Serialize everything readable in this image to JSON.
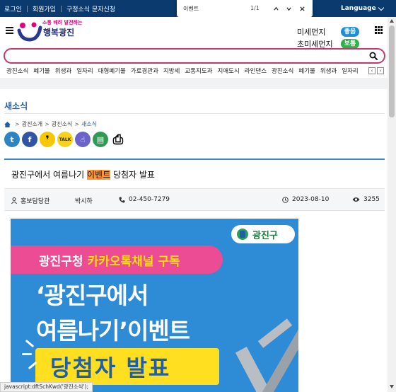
{
  "topbar": {
    "links": [
      "로그인",
      "회원가입",
      "구정소식 문자신청"
    ],
    "language": "Language"
  },
  "findbar": {
    "query": "이벤트",
    "count": "1/1"
  },
  "header": {
    "logo_tagline": "소통 배려 발전하는",
    "logo_name": "행복광진",
    "dust": [
      {
        "label": "미세먼지",
        "status": "좋음",
        "color": "#1f8ed6"
      },
      {
        "label": "초미세먼지",
        "status": "보통",
        "color": "#2eb24a"
      }
    ]
  },
  "search": {
    "value": "",
    "placeholder": ""
  },
  "nav": {
    "items": [
      "광진소식",
      "폐기물",
      "위생과",
      "일자리",
      "대형폐기물",
      "가로경관과",
      "지방세",
      "교통지도과",
      "지애도시",
      "라인댄스",
      "광진소식",
      "폐기물",
      "위생과",
      "일자리"
    ]
  },
  "section": {
    "title": "새소식",
    "breadcrumb": [
      "광진소개",
      "광진소식",
      "새소식"
    ]
  },
  "share_icons": [
    {
      "name": "twitter-icon",
      "glyph": "t",
      "color": "#2d84c5"
    },
    {
      "name": "facebook-icon",
      "glyph": "f",
      "color": "#2f55a4"
    },
    {
      "name": "quote-icon",
      "glyph": "❜",
      "color": "#111111"
    },
    {
      "name": "kakaotalk-icon",
      "glyph": "TALK",
      "color": "#f7d21a"
    },
    {
      "name": "link-icon",
      "glyph": "☝",
      "color": "#6b63c9"
    },
    {
      "name": "document-icon",
      "glyph": "▤",
      "color": "#2f9a55"
    },
    {
      "name": "print-icon",
      "glyph": "⎙",
      "color": "#111111"
    }
  ],
  "post": {
    "title_before": "광진구에서 여름나기 ",
    "title_highlight": "이벤트",
    "title_after": " 당첨자 발표",
    "department": "홍보담당관",
    "author": "박시하",
    "phone": "02-450-7279",
    "date": "2023-08-10",
    "views": "3255"
  },
  "banner": {
    "org": "광진구",
    "subtitle_prefix": "광진구청",
    "subtitle_highlight": "카카오톡채널 구독",
    "line1": "‘광진구에서",
    "line2": "여름나기’이벤트",
    "line3": "당첨자 발표"
  },
  "status_bar": "javascript:dftSchKwd('광진소식');"
}
